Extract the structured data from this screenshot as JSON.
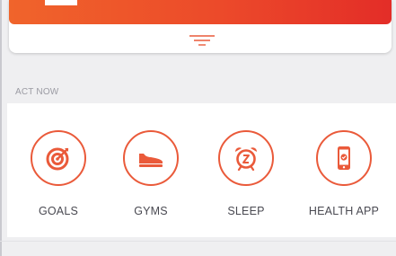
{
  "colors": {
    "accent": "#ea5a3a",
    "banner_start": "#f0642b",
    "banner_end": "#e32d28",
    "label_text": "#4a4a52",
    "section_text": "#9b9ba3"
  },
  "top_card": {
    "handle_icon": "drag-handle-icon"
  },
  "act_now": {
    "section_title": "ACT NOW",
    "items": [
      {
        "label": "GOALS",
        "icon": "target-icon"
      },
      {
        "label": "GYMS",
        "icon": "sneaker-icon"
      },
      {
        "label": "SLEEP",
        "icon": "alarm-clock-icon"
      },
      {
        "label": "HEALTH APP",
        "icon": "phone-check-icon"
      }
    ]
  }
}
